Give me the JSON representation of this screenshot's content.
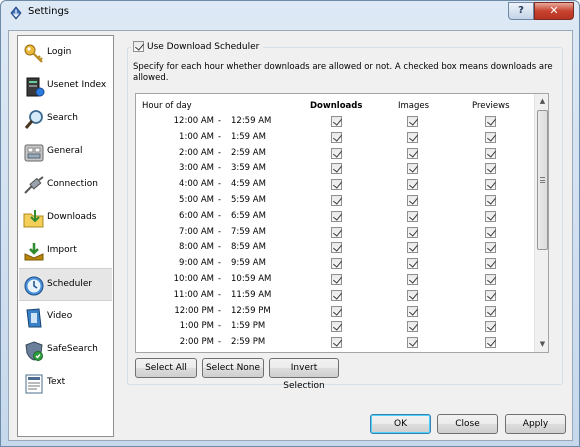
{
  "window": {
    "title": "Settings",
    "help_label": "?",
    "close_label": "✕"
  },
  "sidebar": {
    "items": [
      {
        "label": "Login",
        "icon": "key-icon"
      },
      {
        "label": "Usenet Index",
        "icon": "server-icon"
      },
      {
        "label": "Search",
        "icon": "magnifier-icon"
      },
      {
        "label": "General",
        "icon": "general-icon"
      },
      {
        "label": "Connection",
        "icon": "cable-icon"
      },
      {
        "label": "Downloads",
        "icon": "folder-download-icon"
      },
      {
        "label": "Import",
        "icon": "import-icon"
      },
      {
        "label": "Scheduler",
        "icon": "clock-icon"
      },
      {
        "label": "Video",
        "icon": "film-icon"
      },
      {
        "label": "SafeSearch",
        "icon": "shield-icon"
      },
      {
        "label": "Text",
        "icon": "text-doc-icon"
      }
    ],
    "selected": "Scheduler"
  },
  "scheduler": {
    "use_label": "Use Download Scheduler",
    "use_checked": true,
    "description": "Specify for each hour whether downloads are allowed or not. A checked box means downloads are allowed.",
    "headers": {
      "hour": "Hour of day",
      "downloads": "Downloads",
      "images": "Images",
      "previews": "Previews"
    },
    "rows": [
      {
        "from": "12:00 AM",
        "to": "12:59 AM"
      },
      {
        "from": "1:00 AM",
        "to": "1:59 AM"
      },
      {
        "from": "2:00 AM",
        "to": "2:59 AM"
      },
      {
        "from": "3:00 AM",
        "to": "3:59 AM"
      },
      {
        "from": "4:00 AM",
        "to": "4:59 AM"
      },
      {
        "from": "5:00 AM",
        "to": "5:59 AM"
      },
      {
        "from": "6:00 AM",
        "to": "6:59 AM"
      },
      {
        "from": "7:00 AM",
        "to": "7:59 AM"
      },
      {
        "from": "8:00 AM",
        "to": "8:59 AM"
      },
      {
        "from": "9:00 AM",
        "to": "9:59 AM"
      },
      {
        "from": "10:00 AM",
        "to": "10:59 AM"
      },
      {
        "from": "11:00 AM",
        "to": "11:59 AM"
      },
      {
        "from": "12:00 PM",
        "to": "12:59 PM"
      },
      {
        "from": "1:00 PM",
        "to": "1:59 PM"
      },
      {
        "from": "2:00 PM",
        "to": "2:59 PM"
      }
    ],
    "dash": "-",
    "select_all_label": "Select All",
    "select_none_label": "Select None",
    "invert_label": "Invert Selection"
  },
  "footer": {
    "ok_label": "OK",
    "close_label": "Close",
    "apply_label": "Apply"
  }
}
